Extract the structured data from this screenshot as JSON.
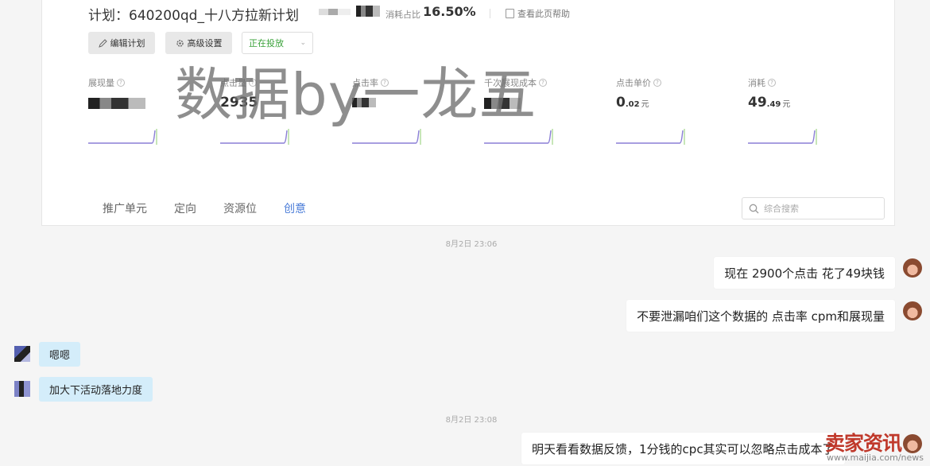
{
  "plan": {
    "title": "计划：640200qd_十八方拉新计划",
    "share_label": "消耗占比",
    "share_value": "16.50%",
    "help_link": "查看此页帮助"
  },
  "buttons": {
    "edit_plan": "编辑计划",
    "advanced_settings": "高级设置",
    "status": "正在投放"
  },
  "metrics": [
    {
      "label": "展现量",
      "value": "",
      "blurred": true
    },
    {
      "label": "点击量",
      "value": "2935",
      "blurred": false
    },
    {
      "label": "点击率",
      "value": "",
      "blurred": true
    },
    {
      "label": "千次展现成本",
      "value": "",
      "blurred": true
    },
    {
      "label": "点击单价",
      "value_main": "0",
      "value_decimal": ".02",
      "unit": "元"
    },
    {
      "label": "消耗",
      "value_main": "49",
      "value_decimal": ".49",
      "unit": "元"
    }
  ],
  "tabs": [
    "推广单元",
    "定向",
    "资源位",
    "创意"
  ],
  "active_tab": "创意",
  "search": {
    "placeholder": "综合搜索"
  },
  "watermark": "数据by一龙五",
  "chat": {
    "timestamp_1": "8月2日  23:06",
    "timestamp_2": "8月2日  23:08",
    "msg_1": "现在 2900个点击 花了49块钱",
    "msg_2": "不要泄漏咱们这个数据的 点击率 cpm和展现量",
    "msg_3": "嗯嗯",
    "msg_4": "加大下活动落地力度",
    "msg_5": "明天看看数据反馈，1分钱的cpc其实可以忽略点击成本了"
  },
  "corner_watermark": {
    "logo": "卖家资讯",
    "url": "www.maijia.com/news"
  },
  "colors": {
    "accent": "#4a7cd8",
    "status_green": "#38a138",
    "incoming_bubble": "#d4edfa",
    "sparkline": "#8b7fd6"
  }
}
